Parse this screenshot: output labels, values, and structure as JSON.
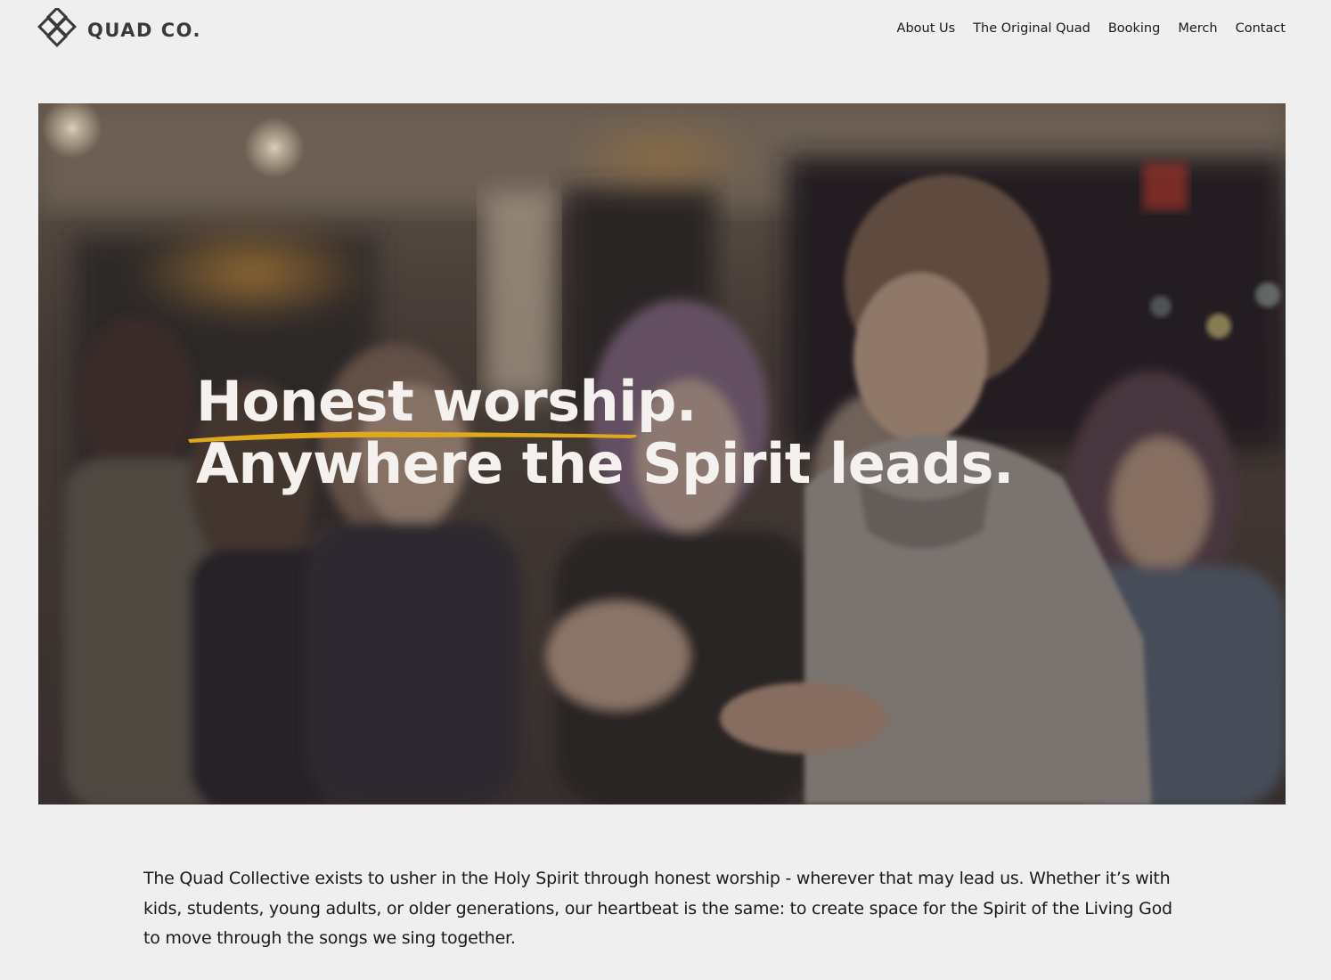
{
  "brand": {
    "name": "QUAD CO.",
    "logo_icon": "diamond-lattice-logo-icon"
  },
  "nav": {
    "items": [
      {
        "label": "About Us"
      },
      {
        "label": "The Original Quad"
      },
      {
        "label": "Booking"
      },
      {
        "label": "Merch"
      },
      {
        "label": "Contact"
      }
    ]
  },
  "hero": {
    "headline_line1": "Honest worship.",
    "headline_line2": "Anywhere the Spirit leads.",
    "underline_color": "#e0a91b"
  },
  "intro": {
    "text": "The Quad Collective exists to usher in the Holy Spirit through honest worship - wherever that may lead us. Whether it’s with kids, students, young adults, or older generations, our heartbeat is the same: to create space for the Spirit of the Living God to move through the songs we sing together."
  }
}
